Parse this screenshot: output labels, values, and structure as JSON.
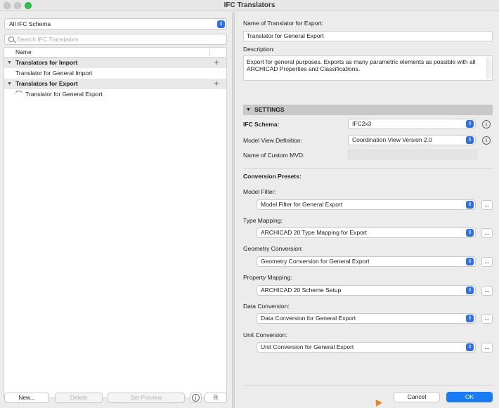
{
  "window": {
    "title": "IFC Translators"
  },
  "left": {
    "schema_filter": "All IFC Schema",
    "search_placeholder": "Search IFC Translators",
    "column_name": "Name",
    "groups": [
      {
        "label": "Translators for Import",
        "items": [
          "Translator for General Import"
        ]
      },
      {
        "label": "Translators for Export",
        "items": [
          "Translator for General Export"
        ]
      }
    ],
    "buttons": {
      "new": "New...",
      "delete": "Delete",
      "set_preview": "Set Preview"
    }
  },
  "right": {
    "name_label": "Name of Translator for Export:",
    "name_value": "Translator for General Export",
    "description_label": "Description:",
    "description_value": "Export for general purposes. Exports as many parametric elements as possible with all ARCHICAD Properties and Classifications.",
    "settings_header": "SETTINGS",
    "ifc_schema_label": "IFC Schema:",
    "ifc_schema_value": "IFC2x3",
    "mvd_label": "Model View Definition:",
    "mvd_value": "Coordination View Version 2.0",
    "custom_mvd_label": "Name of Custom MVD:",
    "custom_mvd_value": "",
    "presets_header": "Conversion Presets:",
    "presets": [
      {
        "label": "Model Filter:",
        "value": "Model Filter for General Export"
      },
      {
        "label": "Type Mapping:",
        "value": "ARCHICAD 20 Type Mapping for Export"
      },
      {
        "label": "Geometry Conversion:",
        "value": "Geometry Conversion for General Export"
      },
      {
        "label": "Property Mapping:",
        "value": "ARCHICAD 20 Scheme Setup"
      },
      {
        "label": "Data Conversion:",
        "value": "Data Conversion for General Export"
      },
      {
        "label": "Unit Conversion:",
        "value": "Unit Conversion for General Export"
      }
    ],
    "more_label": "...",
    "cancel": "Cancel",
    "ok": "OK"
  },
  "colors": {
    "accent": "#2f6fe8",
    "ok_button": "#1a7cf5",
    "cursor": "#f07f1c"
  }
}
